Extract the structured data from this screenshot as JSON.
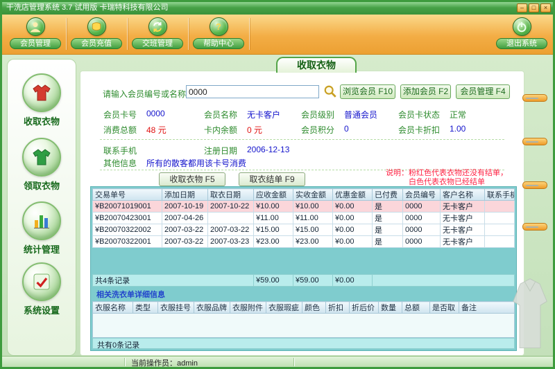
{
  "window": {
    "title": "干洗店管理系统  3.7 试用版 卡瑞特科技有限公司",
    "buttons": {
      "minimize": "–",
      "maximize": "□",
      "close": "×"
    }
  },
  "colors": {
    "accent_green": "#3f9e3f",
    "toolbar_orange": "#f3ad45",
    "unsettled_pink": "#fbd6da",
    "settled_white": "#ffffff",
    "panel_teal": "#7fccce"
  },
  "toolbar": {
    "items": [
      {
        "label": "会员管理",
        "icon": "member-icon"
      },
      {
        "label": "会员充值",
        "icon": "recharge-icon"
      },
      {
        "label": "交班管理",
        "icon": "shift-icon"
      },
      {
        "label": "帮助中心",
        "icon": "help-icon"
      }
    ],
    "exit_label": "退出系统",
    "exit_icon": "power-icon"
  },
  "sidebar": {
    "items": [
      {
        "label": "收取衣物",
        "icon": "receive-clothes-icon"
      },
      {
        "label": "领取衣物",
        "icon": "pickup-clothes-icon"
      },
      {
        "label": "统计管理",
        "icon": "statistics-icon"
      },
      {
        "label": "系统设置",
        "icon": "settings-icon"
      }
    ]
  },
  "main": {
    "tab_title": "收取衣物",
    "search": {
      "label": "请输入会员编号或名称:",
      "value": "0000",
      "icon": "search-icon",
      "browse_button": "浏览会员 F10",
      "add_button": "添加会员 F2",
      "manage_button": "会员管理 F4"
    },
    "member": {
      "card_no_label": "会员卡号",
      "card_no": "0000",
      "name_label": "会员名称",
      "name": "无卡客户",
      "level_label": "会员级别",
      "level": "普通会员",
      "card_status_label": "会员卡状态",
      "card_status": "正常",
      "spend_total_label": "消费总额",
      "spend_total": "48",
      "spend_total_unit": "元",
      "balance_label": "卡内余额",
      "balance": "0",
      "balance_unit": "元",
      "points_label": "会员积分",
      "points": "0",
      "discount_label": "会员卡折扣",
      "discount": "1.00",
      "phone_label": "联系手机",
      "phone": "",
      "reg_date_label": "注册日期",
      "reg_date": "2006-12-13",
      "other_label": "其他信息",
      "other": "所有的散客都用该卡号消费"
    },
    "receive_button": "收取衣物 F5",
    "settle_button": "取衣结单 F9",
    "notice_line1": "说明：粉红色代表衣物还没有结单，",
    "notice_line2": "白色代表衣物已经结单",
    "orders": {
      "headers": [
        "交易单号",
        "添加日期",
        "取衣日期",
        "应收金额",
        "实收金额",
        "优惠金额",
        "已付费",
        "会员编号",
        "客户名称",
        "联系手机"
      ],
      "rows": [
        {
          "settled": false,
          "cells": [
            "¥B20071019001",
            "2007-10-19",
            "2007-10-22",
            "¥10.00",
            "¥10.00",
            "¥0.00",
            "是",
            "0000",
            "无卡客户",
            ""
          ]
        },
        {
          "settled": true,
          "cells": [
            "¥B20070423001",
            "2007-04-26",
            "",
            "¥11.00",
            "¥11.00",
            "¥0.00",
            "是",
            "0000",
            "无卡客户",
            ""
          ]
        },
        {
          "settled": true,
          "cells": [
            "¥B20070322002",
            "2007-03-22",
            "2007-03-22",
            "¥15.00",
            "¥15.00",
            "¥0.00",
            "是",
            "0000",
            "无卡客户",
            ""
          ]
        },
        {
          "settled": true,
          "cells": [
            "¥B20070322001",
            "2007-03-22",
            "2007-03-23",
            "¥23.00",
            "¥23.00",
            "¥0.00",
            "是",
            "0000",
            "无卡客户",
            ""
          ]
        }
      ],
      "footer": {
        "count": "共4条记录",
        "sum_due": "¥59.00",
        "sum_paid": "¥59.00",
        "sum_discount": "¥0.00"
      }
    },
    "details": {
      "title": "相关洗衣单详细信息",
      "headers": [
        "衣服名称",
        "类型",
        "衣服挂号",
        "衣服品牌",
        "衣服附件",
        "衣服瑕疵",
        "颜色",
        "折扣",
        "折后价",
        "数量",
        "总额",
        "是否取",
        "备注"
      ],
      "footer_count": "共有0条记录"
    }
  },
  "statusbar": {
    "operator_label": "当前操作员：",
    "operator": "admin"
  }
}
